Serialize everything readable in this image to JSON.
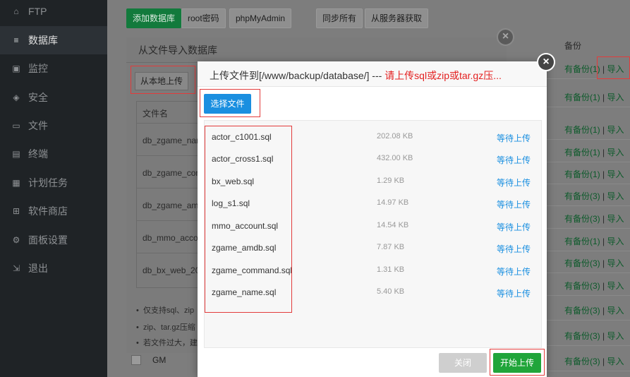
{
  "sidebar": {
    "items": [
      {
        "label": "FTP",
        "icon": "ftp-icon",
        "glyph": "⌂"
      },
      {
        "label": "数据库",
        "icon": "database-icon",
        "glyph": "≡",
        "active": true
      },
      {
        "label": "监控",
        "icon": "monitor-icon",
        "glyph": "▣"
      },
      {
        "label": "安全",
        "icon": "shield-icon",
        "glyph": "◈"
      },
      {
        "label": "文件",
        "icon": "folder-icon",
        "glyph": "▭"
      },
      {
        "label": "终端",
        "icon": "terminal-icon",
        "glyph": "▤"
      },
      {
        "label": "计划任务",
        "icon": "calendar-icon",
        "glyph": "▦"
      },
      {
        "label": "软件商店",
        "icon": "apps-icon",
        "glyph": "⊞"
      },
      {
        "label": "面板设置",
        "icon": "gear-icon",
        "glyph": "⚙"
      },
      {
        "label": "退出",
        "icon": "logout-icon",
        "glyph": "⇲"
      }
    ]
  },
  "toolbar": {
    "add_db": "添加数据库",
    "root_pwd": "root密码",
    "phpmyadmin": "phpMyAdmin",
    "sync_all": "同步所有",
    "fetch_server": "从服务器获取"
  },
  "backup_column": {
    "header": "备份",
    "rows": [
      {
        "has": "有备份(1)",
        "sep": " | ",
        "action": "导入"
      },
      {
        "has": "有备份(1)",
        "sep": " | ",
        "action": "导入"
      },
      {
        "has": "有备份(1)",
        "sep": " | ",
        "action": "导入"
      },
      {
        "has": "有备份(1)",
        "sep": " | ",
        "action": "导入"
      },
      {
        "has": "有备份(1)",
        "sep": " | ",
        "action": "导入"
      },
      {
        "has": "有备份(3)",
        "sep": " | ",
        "action": "导入"
      },
      {
        "has": "有备份(3)",
        "sep": " | ",
        "action": "导入"
      },
      {
        "has": "有备份(1)",
        "sep": " | ",
        "action": "导入"
      },
      {
        "has": "有备份(3)",
        "sep": " | ",
        "action": "导入"
      },
      {
        "has": "有备份(3)",
        "sep": " | ",
        "action": "导入"
      },
      {
        "has": "有备份(3)",
        "sep": " | ",
        "action": "导入"
      },
      {
        "has": "有备份(3)",
        "sep": " | ",
        "action": "导入"
      },
      {
        "has": "有备份(3)",
        "sep": " | ",
        "action": "导入"
      },
      {
        "has": "有备份(3)",
        "sep": " | ",
        "action": "导入"
      }
    ],
    "gm_label": "GM"
  },
  "import_dialog": {
    "title": "从文件导入数据库",
    "local_upload": "从本地上传",
    "col_filename": "文件名",
    "files": [
      "db_zgame_nam",
      "db_zgame_com",
      "db_zgame_amd",
      "db_mmo_accou",
      "db_bx_web_202"
    ],
    "tips": [
      "仅支持sql、zip",
      "zip、tar.gz压缩",
      "若文件过大，建"
    ]
  },
  "upload_dialog": {
    "title_prefix": "上传文件到[/www/backup/database/] --- ",
    "title_warn": "请上传sql或zip或tar.gz压...",
    "choose_file": "选择文件",
    "files": [
      {
        "name": "actor_c1001.sql",
        "size": "202.08 KB",
        "status": "等待上传"
      },
      {
        "name": "actor_cross1.sql",
        "size": "432.00 KB",
        "status": "等待上传"
      },
      {
        "name": "bx_web.sql",
        "size": "1.29 KB",
        "status": "等待上传"
      },
      {
        "name": "log_s1.sql",
        "size": "14.97 KB",
        "status": "等待上传"
      },
      {
        "name": "mmo_account.sql",
        "size": "14.54 KB",
        "status": "等待上传"
      },
      {
        "name": "zgame_amdb.sql",
        "size": "7.87 KB",
        "status": "等待上传"
      },
      {
        "name": "zgame_command.sql",
        "size": "1.31 KB",
        "status": "等待上传"
      },
      {
        "name": "zgame_name.sql",
        "size": "5.40 KB",
        "status": "等待上传"
      }
    ],
    "close_btn": "关闭",
    "start_btn": "开始上传"
  },
  "colors": {
    "accent_blue": "#1a8fe0",
    "accent_green": "#20a53a",
    "warn_red": "#e32121"
  }
}
